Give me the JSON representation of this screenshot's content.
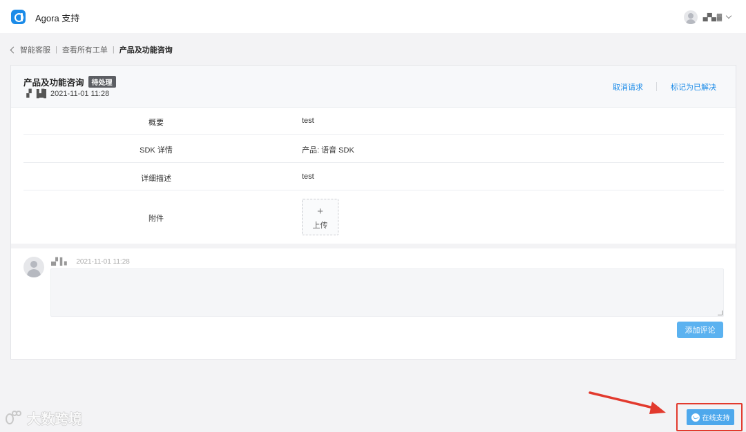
{
  "header": {
    "app_title": "Agora 支持",
    "username": "▄▀▄ ▓"
  },
  "breadcrumb": {
    "items": [
      "智能客服",
      "查看所有工单"
    ],
    "current": "产品及功能咨询"
  },
  "ticket": {
    "title": "产品及功能咨询",
    "status_badge": "待处理",
    "author": "▗▘▐▟▌",
    "created_at": "2021-11-01 11:28",
    "actions": {
      "cancel": "取消请求",
      "resolve": "标记为已解决"
    },
    "fields": [
      {
        "label": "概要",
        "value": "test"
      },
      {
        "label": "SDK 详情",
        "value": "产品: 语音 SDK"
      },
      {
        "label": "详细描述",
        "value": "test"
      },
      {
        "label": "附件",
        "value": ""
      }
    ],
    "upload": {
      "plus": "+",
      "label": "上传"
    }
  },
  "comment": {
    "author": "▄▘▌▖",
    "timestamp": "2021-11-01 11:28",
    "value": "",
    "submit_label": "添加评论"
  },
  "watermark": {
    "text": "大数跨境"
  },
  "support": {
    "label": "在线支持"
  },
  "colors": {
    "accent": "#1b8be8",
    "button": "#5bb2f0",
    "highlight": "#e23a2e"
  }
}
